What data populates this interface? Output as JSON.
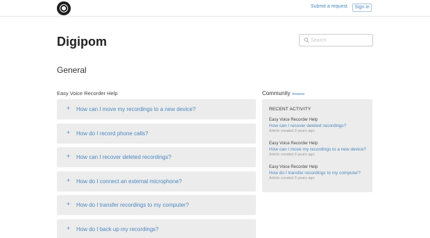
{
  "header": {
    "logo_icon": "disc-logo-icon",
    "submit_request": "Submit a request",
    "sign_in": "Sign in"
  },
  "brand": {
    "name": "Digipom"
  },
  "search": {
    "placeholder": "Search",
    "icon": "search-icon"
  },
  "section": {
    "title": "General"
  },
  "category": {
    "title": "Easy Voice Recorder Help",
    "articles": [
      {
        "label": "How can I move my recordings to a new device?"
      },
      {
        "label": "How do I record phone calls?"
      },
      {
        "label": "How can I recover deleted recordings?"
      },
      {
        "label": "How do I connect an external microphone?"
      },
      {
        "label": "How do I transfer recordings to my computer?"
      },
      {
        "label": "How do I back up my recordings?"
      }
    ]
  },
  "community": {
    "title": "Community",
    "browse": "browse",
    "activity_title": "RECENT ACTIVITY",
    "items": [
      {
        "category": "Easy Voice Recorder Help",
        "link": "How can I recover deleted recordings?",
        "meta": "Article created 3 years ago"
      },
      {
        "category": "Easy Voice Recorder Help",
        "link": "How can I move my recordings to a new device?",
        "meta": "Article created 3 years ago"
      },
      {
        "category": "Easy Voice Recorder Help",
        "link": "How do I transfer recordings to my computer?",
        "meta": "Article created 3 years ago"
      }
    ]
  },
  "colors": {
    "link": "#4a87c0",
    "panel": "#ececec",
    "text": "#333333"
  }
}
